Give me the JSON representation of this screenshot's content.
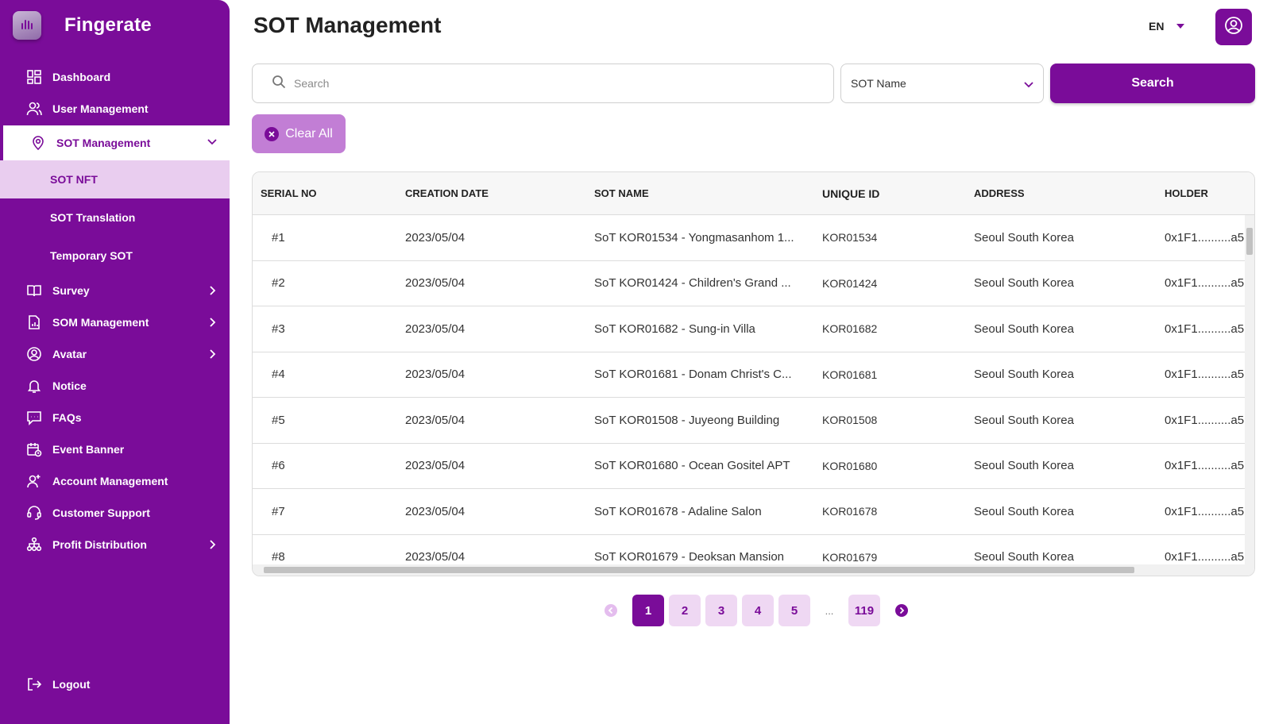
{
  "app": {
    "brand": "Fingerate"
  },
  "header": {
    "title": "SOT Management",
    "language": "EN"
  },
  "sidebar": {
    "items": [
      {
        "label": "Dashboard",
        "icon": "dashboard-icon"
      },
      {
        "label": "User Management",
        "icon": "users-icon"
      },
      {
        "label": "SOT Management",
        "icon": "location-pin-icon",
        "expanded": true
      },
      {
        "label": "Survey",
        "icon": "book-icon"
      },
      {
        "label": "SOM Management",
        "icon": "document-chart-icon"
      },
      {
        "label": "Avatar",
        "icon": "user-circle-icon"
      },
      {
        "label": "Notice",
        "icon": "bell-icon"
      },
      {
        "label": "FAQs",
        "icon": "chat-icon"
      },
      {
        "label": "Event Banner",
        "icon": "calendar-clock-icon"
      },
      {
        "label": "Account Management",
        "icon": "user-plus-icon"
      },
      {
        "label": "Customer Support",
        "icon": "headset-icon"
      },
      {
        "label": "Profit Distribution",
        "icon": "hierarchy-icon"
      }
    ],
    "sot_sub_items": [
      {
        "label": "SOT NFT"
      },
      {
        "label": "SOT Translation"
      },
      {
        "label": "Temporary SOT"
      }
    ],
    "logout": "Logout"
  },
  "search": {
    "placeholder": "Search",
    "filter_value": "SOT Name",
    "button": "Search",
    "clear": "Clear All"
  },
  "table": {
    "headers": [
      "SERIAL NO",
      "CREATION DATE",
      "SOT NAME",
      "UNIQUE ID",
      "ADDRESS",
      "HOLDER"
    ],
    "rows": [
      {
        "serial": "#1",
        "date": "2023/05/04",
        "name": "SoT KOR01534 - Yongmasanhom 1...",
        "id": "KOR01534",
        "address": "Seoul South Korea",
        "holder": "0x1F1..........a5"
      },
      {
        "serial": "#2",
        "date": "2023/05/04",
        "name": "SoT KOR01424 - Children's Grand ...",
        "id": "KOR01424",
        "address": "Seoul South Korea",
        "holder": "0x1F1..........a5"
      },
      {
        "serial": "#3",
        "date": "2023/05/04",
        "name": "SoT KOR01682 - Sung-in Villa",
        "id": "KOR01682",
        "address": "Seoul South Korea",
        "holder": "0x1F1..........a5"
      },
      {
        "serial": "#4",
        "date": "2023/05/04",
        "name": "SoT KOR01681 - Donam Christ's C...",
        "id": "KOR01681",
        "address": "Seoul South Korea",
        "holder": "0x1F1..........a5"
      },
      {
        "serial": "#5",
        "date": "2023/05/04",
        "name": "SoT KOR01508 - Juyeong Building",
        "id": "KOR01508",
        "address": "Seoul South Korea",
        "holder": "0x1F1..........a5"
      },
      {
        "serial": "#6",
        "date": "2023/05/04",
        "name": "SoT KOR01680 - Ocean Gositel APT",
        "id": "KOR01680",
        "address": "Seoul South Korea",
        "holder": "0x1F1..........a5"
      },
      {
        "serial": "#7",
        "date": "2023/05/04",
        "name": "SoT KOR01678 - Adaline Salon",
        "id": "KOR01678",
        "address": "Seoul South Korea",
        "holder": "0x1F1..........a5"
      },
      {
        "serial": "#8",
        "date": "2023/05/04",
        "name": "SoT KOR01679 - Deoksan Mansion",
        "id": "KOR01679",
        "address": "Seoul South Korea",
        "holder": "0x1F1..........a5"
      }
    ]
  },
  "pagination": {
    "pages": [
      "1",
      "2",
      "3",
      "4",
      "5"
    ],
    "ellipsis": "...",
    "last": "119",
    "current": "1"
  },
  "colors": {
    "primary": "#7a0c99",
    "sub_active_bg": "#e9cdef",
    "clear_bg": "#c27ed5",
    "page_bg": "#efd8f3"
  }
}
